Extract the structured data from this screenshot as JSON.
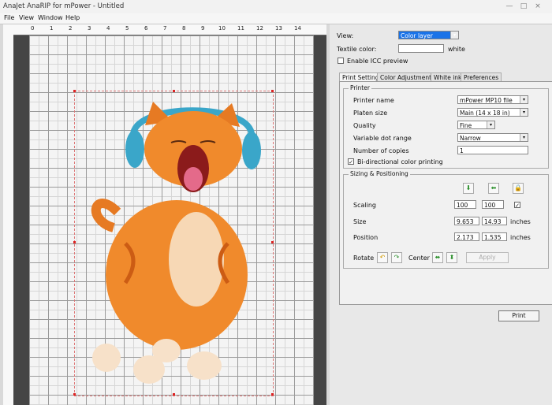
{
  "window": {
    "title": "AnaJet AnaRIP for mPower - Untitled"
  },
  "menu": [
    "File",
    "View",
    "Window",
    "Help"
  ],
  "ruler": {
    "numbers": [
      "0",
      "1",
      "2",
      "3",
      "4",
      "5",
      "6",
      "7",
      "8",
      "9",
      "10",
      "11",
      "12",
      "13",
      "14"
    ]
  },
  "canvas": {
    "image": "kitten-headphones-image"
  },
  "view": {
    "label": "View:",
    "value": "Color layer"
  },
  "textile": {
    "label": "Textile color:",
    "value": "white"
  },
  "icc": {
    "label": "Enable ICC preview",
    "checked": false
  },
  "tabs": [
    "Print Settings",
    "Color Adjustments",
    "White ink",
    "Preferences"
  ],
  "printer": {
    "group": "Printer",
    "name_label": "Printer name",
    "name_value": "mPower MP10 file",
    "size_label": "Platen size",
    "size_value": "Main (14 x 18 in)",
    "quality_label": "Quality",
    "quality_value": "Fine",
    "dot_label": "Variable dot range",
    "dot_value": "Narrow",
    "copies_label": "Number of copies",
    "copies_value": "1",
    "bidir_label": "Bi-directional color printing",
    "bidir_checked": true
  },
  "sizing": {
    "group": "Sizing & Positioning",
    "scaling_label": "Scaling",
    "scaling_x": "100",
    "scaling_y": "100",
    "size_label": "Size",
    "size_w": "9.653",
    "size_h": "14.93",
    "size_unit": "inches",
    "position_label": "Position",
    "pos_x": "2.173",
    "pos_y": "1.535",
    "pos_unit": "inches",
    "rotate_label": "Rotate",
    "center_label": "Center",
    "apply_label": "Apply"
  },
  "print_label": "Print"
}
